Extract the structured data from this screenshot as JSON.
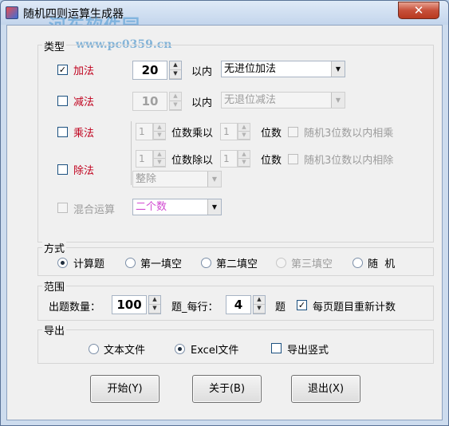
{
  "window": {
    "title": "随机四则运算生成器",
    "close_label": "✕"
  },
  "watermark": {
    "site": "河东软件园",
    "url": "www.pc0359.cn"
  },
  "type_group": {
    "label": "类型",
    "add": {
      "label": "加法",
      "checked": "✓",
      "count": "20",
      "within": "以内",
      "mode": "无进位加法"
    },
    "sub": {
      "label": "减法",
      "checked": "",
      "count": "10",
      "within": "以内",
      "mode": "无退位减法"
    },
    "mul": {
      "label": "乘法",
      "checked": "",
      "a": "1",
      "text1": "位数乘以",
      "b": "1",
      "text2": "位数",
      "random_label": "随机3位数以内相乘"
    },
    "div": {
      "label": "除法",
      "checked": "",
      "a": "1",
      "text1": "位数除以",
      "b": "1",
      "text2": "位数",
      "random_label": "随机3位数以内相除",
      "mode": "整除"
    },
    "mixed": {
      "label": "混合运算",
      "checked": "",
      "mode": "二个数"
    }
  },
  "mode_group": {
    "label": "方式",
    "options": [
      {
        "label": "计算题",
        "selected": true
      },
      {
        "label": "第一填空",
        "selected": false
      },
      {
        "label": "第二填空",
        "selected": false
      },
      {
        "label": "第三填空",
        "selected": false
      },
      {
        "label": "随  机",
        "selected": false
      }
    ]
  },
  "range_group": {
    "label": "范围",
    "count_label": "出题数量：",
    "count": "100",
    "per_line_label": "题_每行：",
    "per_line": "4",
    "unit": "题",
    "renumber_label": "每页题目重新计数",
    "renumber_checked": "✓"
  },
  "export_group": {
    "label": "导出",
    "text_file": "文本文件",
    "excel_file": "Excel文件",
    "vertical_label": "导出竖式",
    "vertical_checked": ""
  },
  "buttons": {
    "start": "开始(Y)",
    "about": "关于(B)",
    "exit": "退出(X)"
  },
  "spinner_up": "▲",
  "spinner_down": "▼",
  "combo_arrow": "▼"
}
